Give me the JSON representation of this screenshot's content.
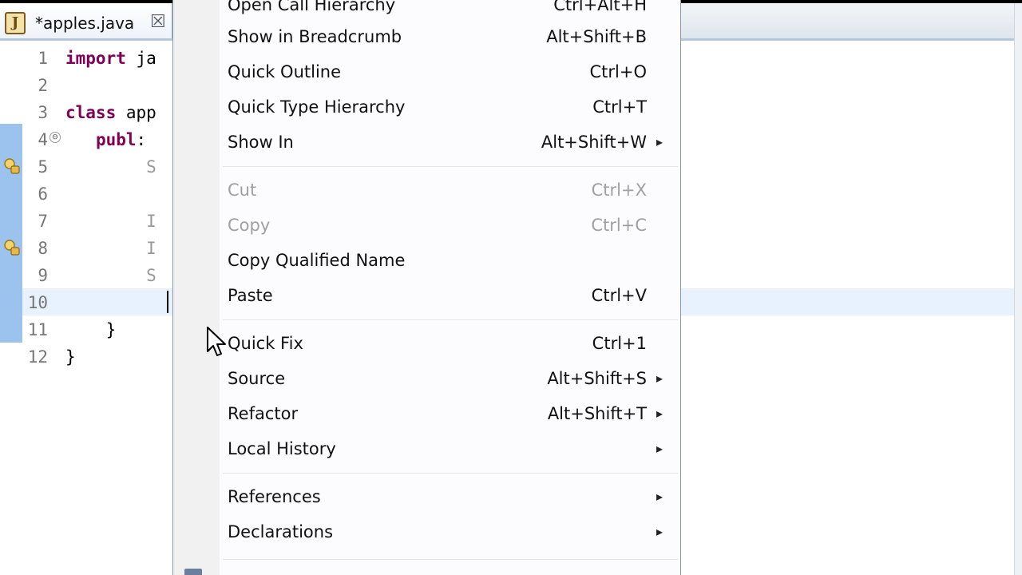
{
  "tab": {
    "icon_letter": "J",
    "title": "*apples.java",
    "close_glyph": "☒"
  },
  "editor": {
    "lines": [
      {
        "no": "1",
        "text": "import ja",
        "keyword": "import"
      },
      {
        "no": "2",
        "text": ""
      },
      {
        "no": "3",
        "text": "class app",
        "keyword": "class"
      },
      {
        "no": "4",
        "text": "    publ:",
        "keyword": "publ"
      },
      {
        "no": "5",
        "text": "        S"
      },
      {
        "no": "6",
        "text": ""
      },
      {
        "no": "7",
        "text": "        I"
      },
      {
        "no": "8",
        "text": "        I"
      },
      {
        "no": "9",
        "text": "        S"
      },
      {
        "no": "10",
        "text": ""
      },
      {
        "no": "11",
        "text": "    }"
      },
      {
        "no": "12",
        "text": "}"
      }
    ],
    "fold_glyph": "⊖"
  },
  "menu": {
    "items": [
      {
        "label": "Open Call Hierarchy",
        "key": "Ctrl+Alt+H",
        "arrow": "",
        "disabled": false
      },
      {
        "label": "Show in Breadcrumb",
        "key": "Alt+Shift+B",
        "arrow": "",
        "disabled": false
      },
      {
        "label": "Quick Outline",
        "key": "Ctrl+O",
        "arrow": "",
        "disabled": false
      },
      {
        "label": "Quick Type Hierarchy",
        "key": "Ctrl+T",
        "arrow": "",
        "disabled": false
      },
      {
        "label": "Show In",
        "key": "Alt+Shift+W",
        "arrow": "▸",
        "disabled": false
      },
      {
        "label": "Cut",
        "key": "Ctrl+X",
        "arrow": "",
        "disabled": true
      },
      {
        "label": "Copy",
        "key": "Ctrl+C",
        "arrow": "",
        "disabled": true
      },
      {
        "label": "Copy Qualified Name",
        "key": "",
        "arrow": "",
        "disabled": false
      },
      {
        "label": "Paste",
        "key": "Ctrl+V",
        "arrow": "",
        "disabled": false
      },
      {
        "label": "Quick Fix",
        "key": "Ctrl+1",
        "arrow": "",
        "disabled": false
      },
      {
        "label": "Source",
        "key": "Alt+Shift+S",
        "arrow": "▸",
        "disabled": false
      },
      {
        "label": "Refactor",
        "key": "Alt+Shift+T",
        "arrow": "▸",
        "disabled": false
      },
      {
        "label": "Local History",
        "key": "",
        "arrow": "▸",
        "disabled": false
      },
      {
        "label": "References",
        "key": "",
        "arrow": "▸",
        "disabled": false
      },
      {
        "label": "Declarations",
        "key": "",
        "arrow": "▸",
        "disabled": false
      }
    ]
  },
  "colors": {
    "keyword": "#7f0055",
    "ruler_highlight": "#9cc2ee",
    "current_line": "#e8f2fe",
    "disabled_text": "#a0a0a0"
  }
}
